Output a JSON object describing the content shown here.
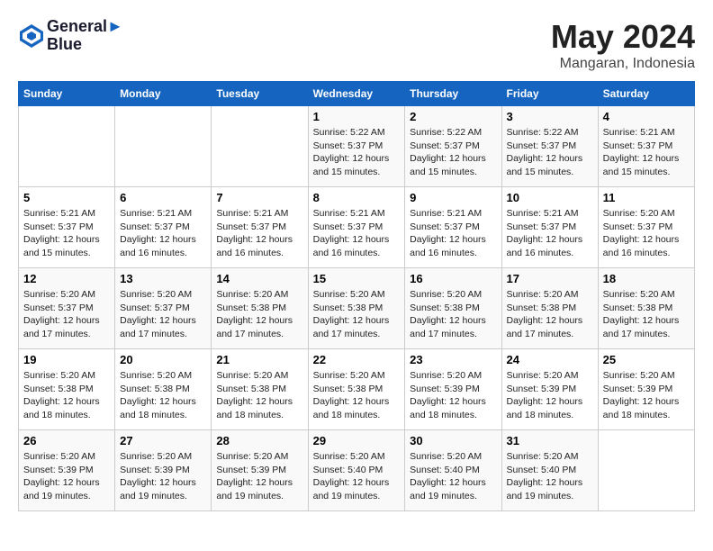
{
  "header": {
    "logo_line1": "General",
    "logo_line2": "Blue",
    "month": "May 2024",
    "location": "Mangaran, Indonesia"
  },
  "weekdays": [
    "Sunday",
    "Monday",
    "Tuesday",
    "Wednesday",
    "Thursday",
    "Friday",
    "Saturday"
  ],
  "weeks": [
    [
      {
        "day": "",
        "info": ""
      },
      {
        "day": "",
        "info": ""
      },
      {
        "day": "",
        "info": ""
      },
      {
        "day": "1",
        "info": "Sunrise: 5:22 AM\nSunset: 5:37 PM\nDaylight: 12 hours\nand 15 minutes."
      },
      {
        "day": "2",
        "info": "Sunrise: 5:22 AM\nSunset: 5:37 PM\nDaylight: 12 hours\nand 15 minutes."
      },
      {
        "day": "3",
        "info": "Sunrise: 5:22 AM\nSunset: 5:37 PM\nDaylight: 12 hours\nand 15 minutes."
      },
      {
        "day": "4",
        "info": "Sunrise: 5:21 AM\nSunset: 5:37 PM\nDaylight: 12 hours\nand 15 minutes."
      }
    ],
    [
      {
        "day": "5",
        "info": "Sunrise: 5:21 AM\nSunset: 5:37 PM\nDaylight: 12 hours\nand 15 minutes."
      },
      {
        "day": "6",
        "info": "Sunrise: 5:21 AM\nSunset: 5:37 PM\nDaylight: 12 hours\nand 16 minutes."
      },
      {
        "day": "7",
        "info": "Sunrise: 5:21 AM\nSunset: 5:37 PM\nDaylight: 12 hours\nand 16 minutes."
      },
      {
        "day": "8",
        "info": "Sunrise: 5:21 AM\nSunset: 5:37 PM\nDaylight: 12 hours\nand 16 minutes."
      },
      {
        "day": "9",
        "info": "Sunrise: 5:21 AM\nSunset: 5:37 PM\nDaylight: 12 hours\nand 16 minutes."
      },
      {
        "day": "10",
        "info": "Sunrise: 5:21 AM\nSunset: 5:37 PM\nDaylight: 12 hours\nand 16 minutes."
      },
      {
        "day": "11",
        "info": "Sunrise: 5:20 AM\nSunset: 5:37 PM\nDaylight: 12 hours\nand 16 minutes."
      }
    ],
    [
      {
        "day": "12",
        "info": "Sunrise: 5:20 AM\nSunset: 5:37 PM\nDaylight: 12 hours\nand 17 minutes."
      },
      {
        "day": "13",
        "info": "Sunrise: 5:20 AM\nSunset: 5:37 PM\nDaylight: 12 hours\nand 17 minutes."
      },
      {
        "day": "14",
        "info": "Sunrise: 5:20 AM\nSunset: 5:38 PM\nDaylight: 12 hours\nand 17 minutes."
      },
      {
        "day": "15",
        "info": "Sunrise: 5:20 AM\nSunset: 5:38 PM\nDaylight: 12 hours\nand 17 minutes."
      },
      {
        "day": "16",
        "info": "Sunrise: 5:20 AM\nSunset: 5:38 PM\nDaylight: 12 hours\nand 17 minutes."
      },
      {
        "day": "17",
        "info": "Sunrise: 5:20 AM\nSunset: 5:38 PM\nDaylight: 12 hours\nand 17 minutes."
      },
      {
        "day": "18",
        "info": "Sunrise: 5:20 AM\nSunset: 5:38 PM\nDaylight: 12 hours\nand 17 minutes."
      }
    ],
    [
      {
        "day": "19",
        "info": "Sunrise: 5:20 AM\nSunset: 5:38 PM\nDaylight: 12 hours\nand 18 minutes."
      },
      {
        "day": "20",
        "info": "Sunrise: 5:20 AM\nSunset: 5:38 PM\nDaylight: 12 hours\nand 18 minutes."
      },
      {
        "day": "21",
        "info": "Sunrise: 5:20 AM\nSunset: 5:38 PM\nDaylight: 12 hours\nand 18 minutes."
      },
      {
        "day": "22",
        "info": "Sunrise: 5:20 AM\nSunset: 5:38 PM\nDaylight: 12 hours\nand 18 minutes."
      },
      {
        "day": "23",
        "info": "Sunrise: 5:20 AM\nSunset: 5:39 PM\nDaylight: 12 hours\nand 18 minutes."
      },
      {
        "day": "24",
        "info": "Sunrise: 5:20 AM\nSunset: 5:39 PM\nDaylight: 12 hours\nand 18 minutes."
      },
      {
        "day": "25",
        "info": "Sunrise: 5:20 AM\nSunset: 5:39 PM\nDaylight: 12 hours\nand 18 minutes."
      }
    ],
    [
      {
        "day": "26",
        "info": "Sunrise: 5:20 AM\nSunset: 5:39 PM\nDaylight: 12 hours\nand 19 minutes."
      },
      {
        "day": "27",
        "info": "Sunrise: 5:20 AM\nSunset: 5:39 PM\nDaylight: 12 hours\nand 19 minutes."
      },
      {
        "day": "28",
        "info": "Sunrise: 5:20 AM\nSunset: 5:39 PM\nDaylight: 12 hours\nand 19 minutes."
      },
      {
        "day": "29",
        "info": "Sunrise: 5:20 AM\nSunset: 5:40 PM\nDaylight: 12 hours\nand 19 minutes."
      },
      {
        "day": "30",
        "info": "Sunrise: 5:20 AM\nSunset: 5:40 PM\nDaylight: 12 hours\nand 19 minutes."
      },
      {
        "day": "31",
        "info": "Sunrise: 5:20 AM\nSunset: 5:40 PM\nDaylight: 12 hours\nand 19 minutes."
      },
      {
        "day": "",
        "info": ""
      }
    ]
  ]
}
